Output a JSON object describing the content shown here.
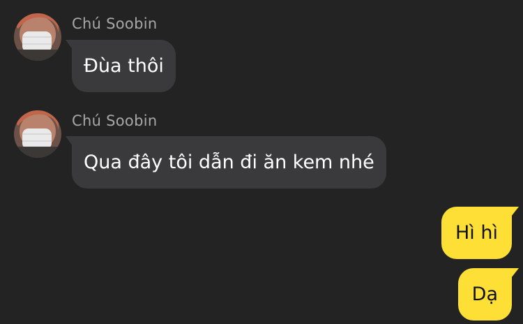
{
  "messages": [
    {
      "direction": "incoming",
      "sender": "Chú Soobin",
      "text": "Đùa thôi",
      "avatar_icon": "person-face-mask-avatar"
    },
    {
      "direction": "incoming",
      "sender": "Chú Soobin",
      "text": "Qua đây tôi dẫn đi ăn kem nhé",
      "avatar_icon": "person-face-mask-avatar"
    },
    {
      "direction": "outgoing",
      "text": "Hì hì"
    },
    {
      "direction": "outgoing",
      "text": "Dạ"
    }
  ],
  "colors": {
    "background": "#232323",
    "incoming_bubble": "#3a3a3c",
    "outgoing_bubble": "#fddf36",
    "sender_name": "#a8a8a8"
  }
}
